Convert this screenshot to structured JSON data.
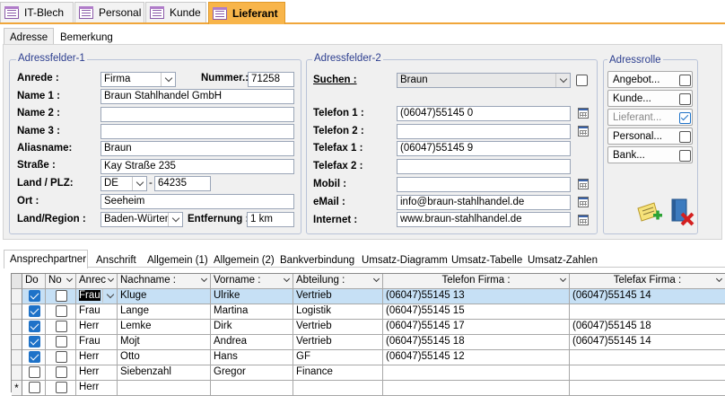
{
  "doc_tabs": [
    {
      "label": "IT-Blech",
      "active": false
    },
    {
      "label": "Personal",
      "active": false
    },
    {
      "label": "Kunde",
      "active": false
    },
    {
      "label": "Lieferant",
      "active": true
    }
  ],
  "sub_tabs": [
    "Adresse",
    "Bemerkung"
  ],
  "adressfelder1": {
    "title": "Adressfelder-1",
    "anrede_label": "Anrede :",
    "anrede_value": "Firma",
    "nummer_label": "Nummer.:",
    "nummer_value": "71258",
    "name1_label": "Name 1 :",
    "name1_value": "Braun Stahlhandel GmbH",
    "name2_label": "Name 2 :",
    "name2_value": "",
    "name3_label": "Name 3 :",
    "name3_value": "",
    "aliasname_label": "Aliasname:",
    "aliasname_value": "Braun",
    "strasse_label": "Straße :",
    "strasse_value": "Kay Straße 235",
    "land_plz_label": "Land / PLZ:",
    "land_value": "DE",
    "plz_separator": "-",
    "plz_value": "64235",
    "ort_label": "Ort :",
    "ort_value": "Seeheim",
    "region_label": "Land/Region :",
    "region_value": "Baden-Würtem",
    "entfernung_label": "Entfernung :",
    "entfernung_value": "1 km"
  },
  "adressfelder2": {
    "title": "Adressfelder-2",
    "suchen_label": "Suchen :",
    "suchen_value": "Braun",
    "telefon1_label": "Telefon 1 :",
    "telefon1_value": "(06047)55145 0",
    "telefon2_label": "Telefon 2 :",
    "telefon2_value": "",
    "telefax1_label": "Telefax 1 :",
    "telefax1_value": "(06047)55145 9",
    "telefax2_label": "Telefax 2 :",
    "telefax2_value": "",
    "mobil_label": "Mobil :",
    "mobil_value": "",
    "email_label": "eMail :",
    "email_value": "info@braun-stahlhandel.de",
    "internet_label": "Internet :",
    "internet_value": "www.braun-stahlhandel.de"
  },
  "adressrolle": {
    "title": "Adressrolle",
    "items": [
      {
        "label": "Angebot...",
        "checked": false,
        "dim": false
      },
      {
        "label": "Kunde...",
        "checked": false,
        "dim": false
      },
      {
        "label": "Lieferant...",
        "checked": true,
        "dim": true
      },
      {
        "label": "Personal...",
        "checked": false,
        "dim": false
      },
      {
        "label": "Bank...",
        "checked": false,
        "dim": false
      }
    ]
  },
  "bottom_tabs": [
    "Ansprechpartner",
    "Anschrift",
    "Allgemein (1)",
    "Allgemein (2)",
    "Bankverbindung",
    "Umsatz-Diagramm",
    "Umsatz-Tabelle",
    "Umsatz-Zahlen"
  ],
  "grid": {
    "headers": [
      "Do",
      "No",
      "Anrec",
      "Nachname :",
      "Vorname :",
      "Abteilung :",
      "Telefon Firma :",
      "Telefax Firma :"
    ],
    "rows": [
      {
        "do": true,
        "no": false,
        "anrede": "Frau",
        "nachname": "Kluge",
        "vorname": "Ulrike",
        "abteilung": "Vertrieb",
        "telefon": "(06047)55145 13",
        "telefax": "(06047)55145 14",
        "selected": true
      },
      {
        "do": true,
        "no": false,
        "anrede": "Frau",
        "nachname": "Lange",
        "vorname": "Martina",
        "abteilung": "Logistik",
        "telefon": "(06047)55145 15",
        "telefax": "",
        "selected": false
      },
      {
        "do": true,
        "no": false,
        "anrede": "Herr",
        "nachname": "Lemke",
        "vorname": "Dirk",
        "abteilung": "Vertrieb",
        "telefon": "(06047)55145 17",
        "telefax": "(06047)55145 18",
        "selected": false
      },
      {
        "do": true,
        "no": false,
        "anrede": "Frau",
        "nachname": "Mojt",
        "vorname": "Andrea",
        "abteilung": "Vertrieb",
        "telefon": "(06047)55145 18",
        "telefax": "(06047)55145 14",
        "selected": false
      },
      {
        "do": true,
        "no": false,
        "anrede": "Herr",
        "nachname": "Otto",
        "vorname": "Hans",
        "abteilung": "GF",
        "telefon": "(06047)55145 12",
        "telefax": "",
        "selected": false
      },
      {
        "do": false,
        "no": false,
        "anrede": "Herr",
        "nachname": "Siebenzahl",
        "vorname": "Gregor",
        "abteilung": "Finance",
        "telefon": "",
        "telefax": "",
        "selected": false
      }
    ],
    "new_row_marker": "*",
    "new_row_anrede": "Herr"
  },
  "colors": {
    "active_tab": "#f8b54a",
    "selection": "#c6e0f5",
    "checkbox": "#1e72c8"
  }
}
